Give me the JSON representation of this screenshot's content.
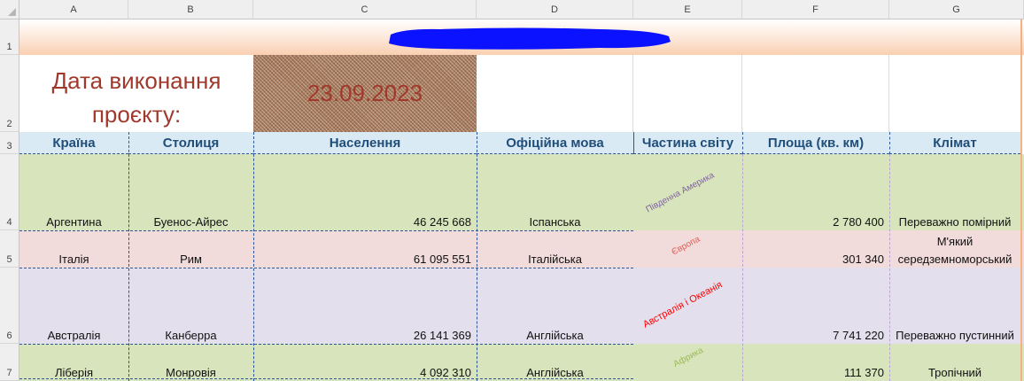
{
  "columns": [
    "A",
    "B",
    "C",
    "D",
    "E",
    "F",
    "G"
  ],
  "rows": [
    "1",
    "2",
    "3",
    "4",
    "5",
    "6",
    "7"
  ],
  "title": {
    "label_line1": "Дата виконання",
    "label_line2": "проєкту:",
    "date": "23.09.2023"
  },
  "headers": [
    "Країна",
    "Столиця",
    "Населення",
    "Офіційна мова",
    "Частина світу",
    "Площа (кв. км)",
    "Клімат"
  ],
  "data_rows": [
    {
      "country": "Аргентина",
      "capital": "Буенос-Айрес",
      "population": "46 245 668",
      "language": "Іспанська",
      "region": "Південна Америка",
      "area": "2 780 400",
      "climate": "Переважно помірний",
      "climate2": ""
    },
    {
      "country": "Італія",
      "capital": "Рим",
      "population": "61 095 551",
      "language": "Італійська",
      "region": "Європа",
      "area": "301 340",
      "climate": "М'який",
      "climate2": "середземноморський"
    },
    {
      "country": "Австралія",
      "capital": "Канберра",
      "population": "26 141 369",
      "language": "Англійська",
      "region": "Австралія і Океанія",
      "area": "7 741 220",
      "climate": "Переважно пустинний",
      "climate2": ""
    },
    {
      "country": "Ліберія",
      "capital": "Монровія",
      "population": "4 092 310",
      "language": "Англійська",
      "region": "Африка",
      "area": "111 370",
      "climate": "Тропічний",
      "climate2": ""
    }
  ],
  "colors": {
    "row_green": "#d8e4bc",
    "row_pink": "#f2dcdb",
    "row_lavender": "#e4dfec",
    "header_bg": "#daeaf5",
    "header_text": "#1f4e79",
    "title_text": "#a0392c",
    "region_south_america": "#8064a2",
    "region_europe": "#e0605a",
    "region_oceania": "#ff0000",
    "region_africa": "#9bbb59",
    "redaction": "#0000ff"
  }
}
